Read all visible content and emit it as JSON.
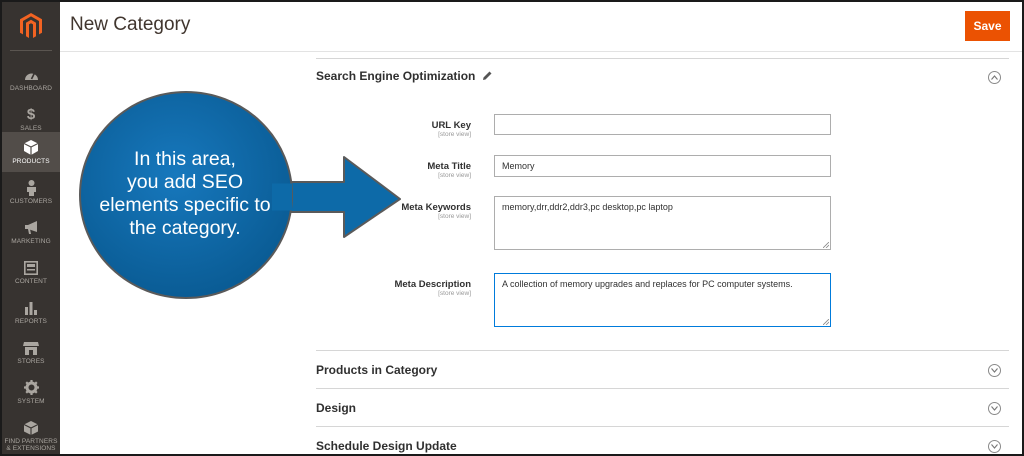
{
  "sidebar": {
    "items": [
      {
        "label": "DASHBOARD",
        "icon": "dashboard-icon"
      },
      {
        "label": "SALES",
        "icon": "dollar-icon"
      },
      {
        "label": "PRODUCTS",
        "icon": "box-icon"
      },
      {
        "label": "CUSTOMERS",
        "icon": "person-icon"
      },
      {
        "label": "MARKETING",
        "icon": "megaphone-icon"
      },
      {
        "label": "CONTENT",
        "icon": "content-icon"
      },
      {
        "label": "REPORTS",
        "icon": "bar-chart-icon"
      },
      {
        "label": "STORES",
        "icon": "store-icon"
      },
      {
        "label": "SYSTEM",
        "icon": "gear-icon"
      },
      {
        "label1": "FIND PARTNERS",
        "label2": "& EXTENSIONS",
        "icon": "extensions-icon"
      }
    ],
    "active_color": "#524d49",
    "bg_color": "#373330"
  },
  "header": {
    "title": "New Category",
    "save_label": "Save",
    "save_color": "#eb5202"
  },
  "seo": {
    "title": "Search Engine Optimization",
    "fields": {
      "url_key": {
        "label": "URL Key",
        "scope": "[store view]",
        "value": ""
      },
      "meta_title": {
        "label": "Meta Title",
        "scope": "[store view]",
        "value": "Memory"
      },
      "meta_keywords": {
        "label": "Meta Keywords",
        "scope": "[store view]",
        "value": "memory,drr,ddr2,ddr3,pc desktop,pc laptop"
      },
      "meta_description": {
        "label": "Meta Description",
        "scope": "[store view]",
        "value": "A collection of memory upgrades and replaces for PC computer systems."
      }
    }
  },
  "sections": {
    "products": "Products in Category",
    "design": "Design",
    "schedule": "Schedule Design Update"
  },
  "callout": {
    "line1": "In this area,",
    "line2": "you add SEO",
    "line3": "elements specific to",
    "line4": "the category.",
    "color": "#0d6aa8"
  }
}
